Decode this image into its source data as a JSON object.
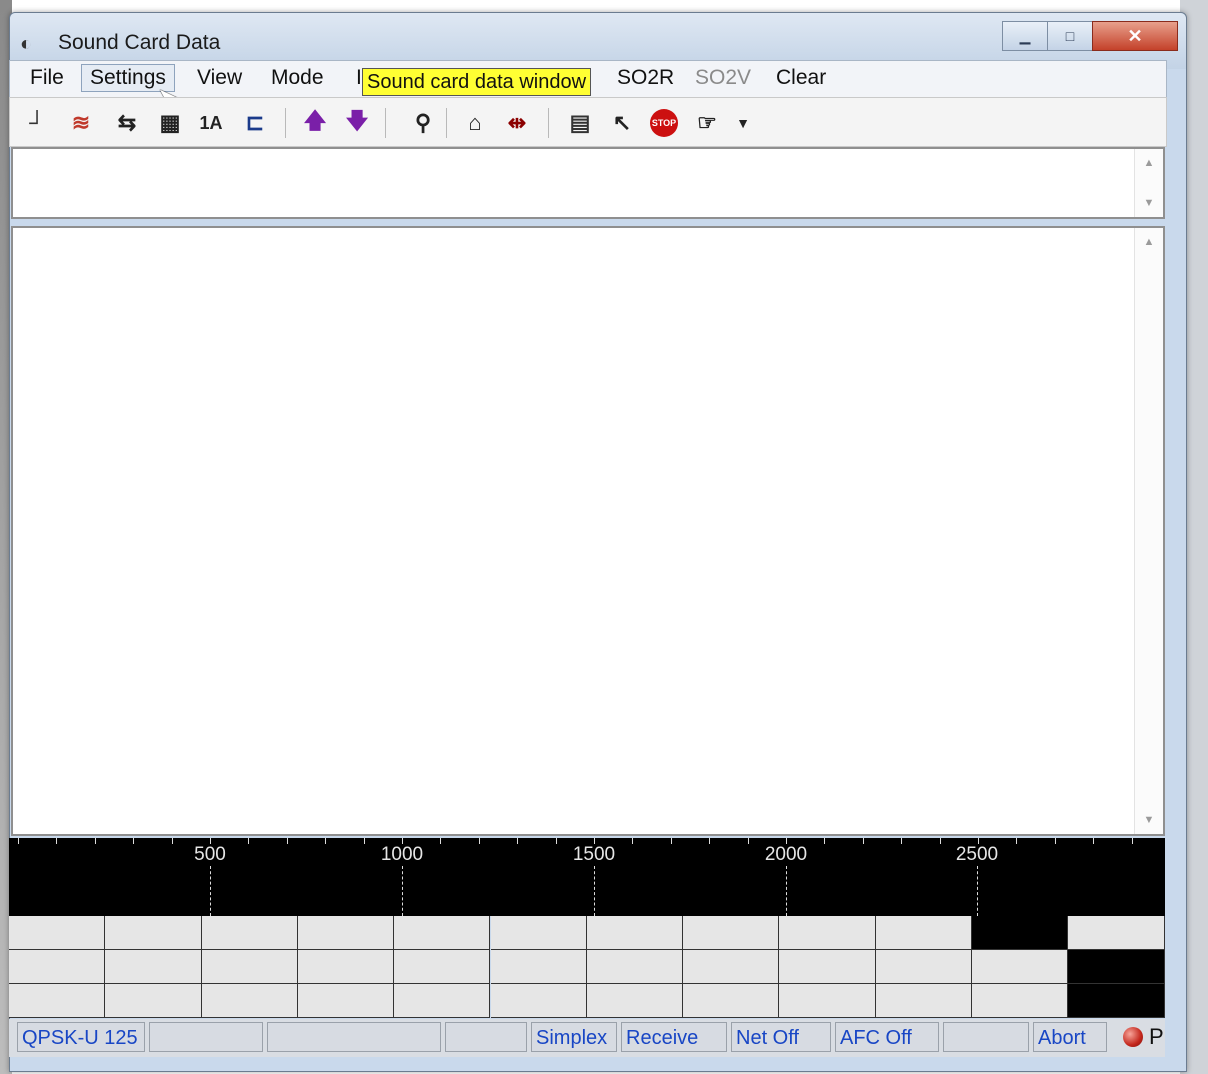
{
  "window": {
    "title": "Sound Card Data",
    "app_icon": "sound-card-icon"
  },
  "menu": {
    "items": [
      {
        "label": "File",
        "disabled": false
      },
      {
        "label": "Settings",
        "disabled": false,
        "hover": true
      },
      {
        "label": "View",
        "disabled": false
      },
      {
        "label": "Mode",
        "disabled": false
      },
      {
        "label": "SO2R",
        "disabled": false
      },
      {
        "label": "SO2V",
        "disabled": true
      },
      {
        "label": "Clear",
        "disabled": false
      }
    ],
    "partial_label": "I"
  },
  "tooltip": "Sound card data window",
  "toolbar": {
    "icons": [
      "receive-icon",
      "wave-icon",
      "swap-icon",
      "save-icon",
      "text-a-icon",
      "filter-icon",
      "arrow-up-icon",
      "arrow-down-icon",
      "find-icon",
      "house-icon",
      "tune-icon",
      "keyboard-icon",
      "magic-wand-icon",
      "stop-icon",
      "hand-icon",
      "dropdown-icon"
    ],
    "stop_label": "STOP",
    "colors": {
      "arrow": "#7a1fa8",
      "stop": "#cc1010"
    }
  },
  "spectrum": {
    "scale": [
      "500",
      "1000",
      "1500",
      "2000",
      "2500"
    ]
  },
  "status": {
    "mode": "QPSK-U 125",
    "simplex": "Simplex",
    "receive": "Receive",
    "net": "Net Off",
    "afc": "AFC Off",
    "abort": "Abort",
    "last": "P"
  }
}
